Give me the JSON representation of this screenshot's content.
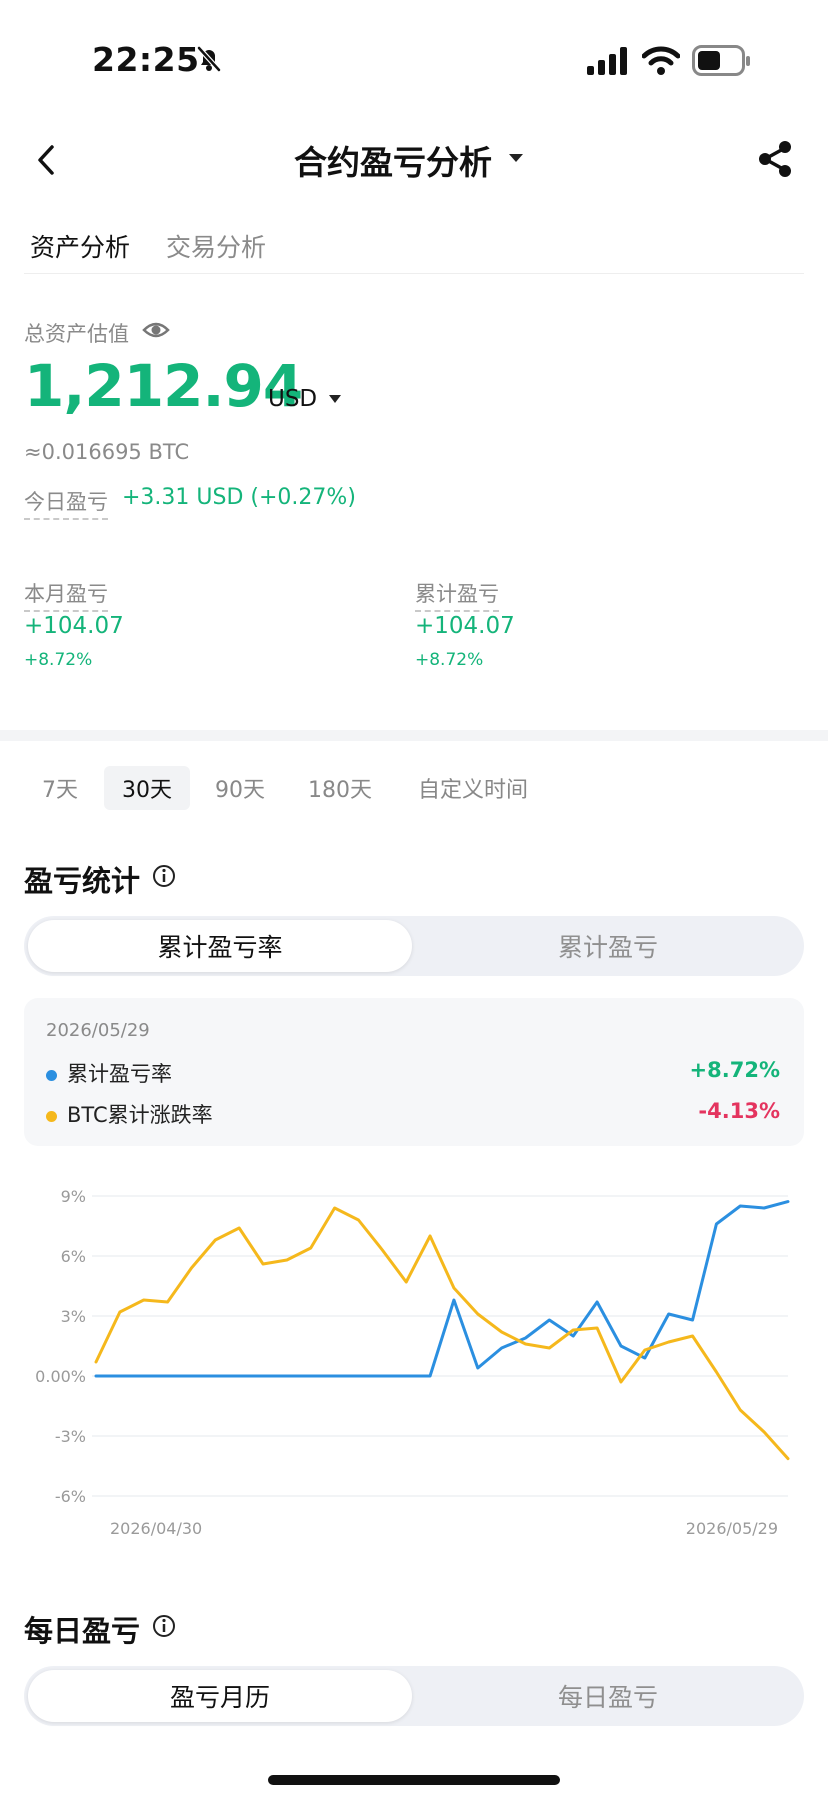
{
  "status_bar": {
    "time": "22:25",
    "bell_muted_icon": "bell-slash-icon",
    "signal_icon": "cellular-signal-icon",
    "wifi_icon": "wifi-icon",
    "battery_icon": "battery-icon"
  },
  "header": {
    "title": "合约盈亏分析",
    "back_icon": "chevron-left-icon",
    "dropdown_icon": "caret-down-icon",
    "share_icon": "share-icon"
  },
  "tabs": [
    {
      "label": "资产分析",
      "active": true
    },
    {
      "label": "交易分析",
      "active": false
    }
  ],
  "assets": {
    "label": "总资产估值",
    "eye_icon": "eye-icon",
    "value": "1,212.94",
    "currency": "USD",
    "btc_equiv": "≈0.016695 BTC",
    "today_label": "今日盈亏",
    "today_value": "+3.31 USD (+0.27%)"
  },
  "summary": {
    "month": {
      "label": "本月盈亏",
      "value": "+104.07",
      "pct": "+8.72%"
    },
    "total": {
      "label": "累计盈亏",
      "value": "+104.07",
      "pct": "+8.72%"
    }
  },
  "ranges": [
    {
      "label": "7天",
      "active": false
    },
    {
      "label": "30天",
      "active": true
    },
    {
      "label": "90天",
      "active": false
    },
    {
      "label": "180天",
      "active": false
    },
    {
      "label": "自定义时间",
      "active": false
    }
  ],
  "pnl_stats": {
    "title": "盈亏统计",
    "info_icon": "info-circle-icon",
    "segment": {
      "active": "累计盈亏率",
      "inactive": "累计盈亏"
    },
    "tooltip": {
      "date": "2026/05/29",
      "rows": [
        {
          "label": "累计盈亏率",
          "value": "+8.72%"
        },
        {
          "label": "BTC累计涨跌率",
          "value": "-4.13%"
        }
      ]
    }
  },
  "colors": {
    "up": "#14b47a",
    "down": "#e4345f",
    "series_pnl": "#2b8fe0",
    "series_btc": "#f5b81c"
  },
  "chart_data": {
    "type": "line",
    "x": [
      "2026/04/30",
      "2026/05/01",
      "2026/05/02",
      "2026/05/03",
      "2026/05/04",
      "2026/05/05",
      "2026/05/06",
      "2026/05/07",
      "2026/05/08",
      "2026/05/09",
      "2026/05/10",
      "2026/05/11",
      "2026/05/12",
      "2026/05/13",
      "2026/05/14",
      "2026/05/15",
      "2026/05/16",
      "2026/05/17",
      "2026/05/18",
      "2026/05/19",
      "2026/05/20",
      "2026/05/21",
      "2026/05/22",
      "2026/05/23",
      "2026/05/24",
      "2026/05/25",
      "2026/05/26",
      "2026/05/27",
      "2026/05/28",
      "2026/05/29"
    ],
    "series": [
      {
        "name": "累计盈亏率",
        "color": "#2b8fe0",
        "values": [
          0,
          0,
          0,
          0,
          0,
          0,
          0,
          0,
          0,
          0,
          0,
          0,
          0,
          0,
          0,
          3.8,
          0.4,
          1.4,
          1.9,
          2.8,
          2.0,
          3.7,
          1.5,
          0.9,
          3.1,
          2.8,
          7.6,
          8.5,
          8.4,
          8.72
        ]
      },
      {
        "name": "BTC累计涨跌率",
        "color": "#f5b81c",
        "values": [
          0.7,
          3.2,
          3.8,
          3.7,
          5.4,
          6.8,
          7.4,
          5.6,
          5.8,
          6.4,
          8.4,
          7.8,
          6.3,
          4.7,
          7.0,
          4.4,
          3.1,
          2.2,
          1.6,
          1.4,
          2.3,
          2.4,
          -0.3,
          1.3,
          1.7,
          2.0,
          0.2,
          -1.7,
          -2.8,
          -4.13
        ]
      }
    ],
    "y_ticks": [
      "9%",
      "6%",
      "3%",
      "0.00%",
      "-3%",
      "-6%"
    ],
    "y_tick_values": [
      9,
      6,
      3,
      0,
      -3,
      -6
    ],
    "x_labels": [
      "2026/04/30",
      "2026/05/29"
    ],
    "ylim": [
      -6,
      9
    ],
    "grid": true
  },
  "daily": {
    "title": "每日盈亏",
    "info_icon": "info-circle-icon",
    "segment": {
      "active": "盈亏月历",
      "inactive": "每日盈亏"
    }
  }
}
